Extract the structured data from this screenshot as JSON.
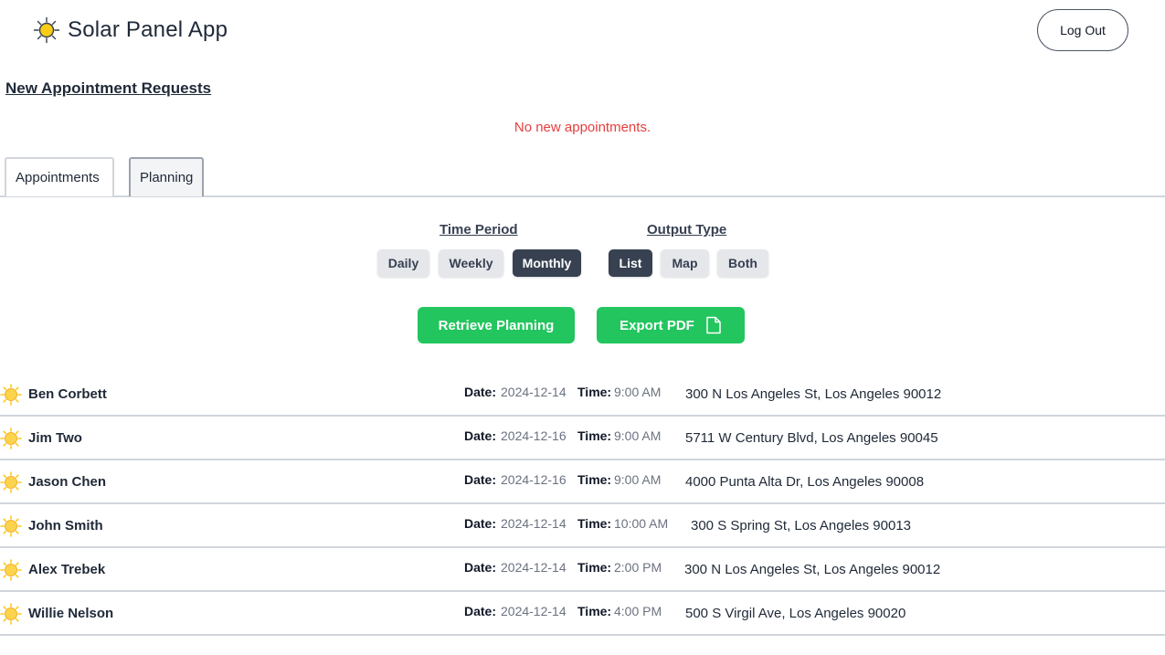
{
  "app": {
    "title": "Solar Panel App",
    "logout_label": "Log Out"
  },
  "requests": {
    "heading": "New Appointment Requests",
    "empty_message": "No new appointments."
  },
  "tabs": [
    {
      "label": "Appointments"
    },
    {
      "label": "Planning",
      "active": true
    }
  ],
  "planning": {
    "time_period": {
      "label": "Time Period",
      "options": [
        "Daily",
        "Weekly",
        "Monthly"
      ],
      "selected": "Monthly"
    },
    "output_type": {
      "label": "Output Type",
      "options": [
        "List",
        "Map",
        "Both"
      ],
      "selected": "List"
    },
    "retrieve_label": "Retrieve Planning",
    "export_label": "Export PDF"
  },
  "field_labels": {
    "date": "Date:",
    "time": "Time:"
  },
  "appointments": [
    {
      "name": "Ben Corbett",
      "date": "2024-12-14",
      "time": "9:00 AM",
      "address": "300 N Los Angeles St, Los Angeles 90012"
    },
    {
      "name": "Jim Two",
      "date": "2024-12-16",
      "time": "9:00 AM",
      "address": "5711 W Century Blvd, Los Angeles 90045"
    },
    {
      "name": "Jason Chen",
      "date": "2024-12-16",
      "time": "9:00 AM",
      "address": "4000 Punta Alta Dr, Los Angeles 90008"
    },
    {
      "name": "John Smith",
      "date": "2024-12-14",
      "time": "10:00 AM",
      "address": "300 S Spring St, Los Angeles 90013"
    },
    {
      "name": "Alex Trebek",
      "date": "2024-12-14",
      "time": "2:00 PM",
      "address": "300 N Los Angeles St, Los Angeles 90012"
    },
    {
      "name": "Willie Nelson",
      "date": "2024-12-14",
      "time": "4:00 PM",
      "address": "500 S Virgil Ave, Los Angeles 90020"
    }
  ],
  "icons": {
    "logo": "sun-icon",
    "row": "sun-icon",
    "export": "document-icon"
  },
  "colors": {
    "accent_green": "#22c55e",
    "active_pill": "#374151",
    "error_red": "#e53e3e"
  }
}
